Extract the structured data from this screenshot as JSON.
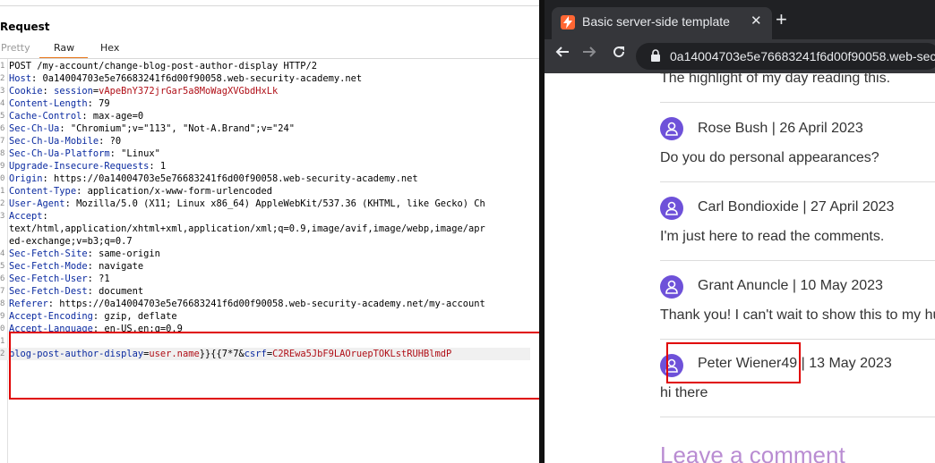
{
  "burp": {
    "title": "Request",
    "tabs": {
      "pretty": "Pretty",
      "raw": "Raw",
      "hex": "Hex"
    },
    "lines": [
      {
        "n": "1",
        "parts": [
          {
            "t": "POST /my-account/change-blog-post-author-display HTTP/2",
            "c": "v"
          }
        ]
      },
      {
        "n": "2",
        "parts": [
          {
            "t": "Host",
            "c": "k"
          },
          {
            "t": ": 0a14004703e5e76683241f6d00f90058.web-security-academy.net",
            "c": "v"
          }
        ]
      },
      {
        "n": "3",
        "parts": [
          {
            "t": "Cookie",
            "c": "k"
          },
          {
            "t": ": ",
            "c": "v"
          },
          {
            "t": "session",
            "c": "ck"
          },
          {
            "t": "=",
            "c": "v"
          },
          {
            "t": "vApeBnY372jrGar5a8MoWagXVGbdHxLk",
            "c": "cv"
          }
        ]
      },
      {
        "n": "4",
        "parts": [
          {
            "t": "Content-Length",
            "c": "k"
          },
          {
            "t": ": 79",
            "c": "v"
          }
        ]
      },
      {
        "n": "5",
        "parts": [
          {
            "t": "Cache-Control",
            "c": "k"
          },
          {
            "t": ": max-age=0",
            "c": "v"
          }
        ]
      },
      {
        "n": "6",
        "parts": [
          {
            "t": "Sec-Ch-Ua",
            "c": "k"
          },
          {
            "t": ": \"Chromium\";v=\"113\", \"Not-A.Brand\";v=\"24\"",
            "c": "v"
          }
        ]
      },
      {
        "n": "7",
        "parts": [
          {
            "t": "Sec-Ch-Ua-Mobile",
            "c": "k"
          },
          {
            "t": ": ?0",
            "c": "v"
          }
        ]
      },
      {
        "n": "8",
        "parts": [
          {
            "t": "Sec-Ch-Ua-Platform",
            "c": "k"
          },
          {
            "t": ": \"Linux\"",
            "c": "v"
          }
        ]
      },
      {
        "n": "9",
        "parts": [
          {
            "t": "Upgrade-Insecure-Requests",
            "c": "k"
          },
          {
            "t": ": 1",
            "c": "v"
          }
        ]
      },
      {
        "n": "0",
        "parts": [
          {
            "t": "Origin",
            "c": "k"
          },
          {
            "t": ": https://0a14004703e5e76683241f6d00f90058.web-security-academy.net",
            "c": "v"
          }
        ]
      },
      {
        "n": "1",
        "parts": [
          {
            "t": "Content-Type",
            "c": "k"
          },
          {
            "t": ": application/x-www-form-urlencoded",
            "c": "v"
          }
        ]
      },
      {
        "n": "2",
        "parts": [
          {
            "t": "User-Agent",
            "c": "k"
          },
          {
            "t": ": Mozilla/5.0 (X11; Linux x86_64) AppleWebKit/537.36 (KHTML, like Gecko) Ch",
            "c": "v"
          }
        ]
      },
      {
        "n": "3",
        "parts": [
          {
            "t": "Accept",
            "c": "k"
          },
          {
            "t": ":",
            "c": "v"
          }
        ]
      },
      {
        "n": "",
        "parts": [
          {
            "t": "text/html,application/xhtml+xml,application/xml;q=0.9,image/avif,image/webp,image/apr",
            "c": "v"
          }
        ]
      },
      {
        "n": "",
        "parts": [
          {
            "t": "ed-exchange;v=b3;q=0.7",
            "c": "v"
          }
        ]
      },
      {
        "n": "4",
        "parts": [
          {
            "t": "Sec-Fetch-Site",
            "c": "k"
          },
          {
            "t": ": same-origin",
            "c": "v"
          }
        ]
      },
      {
        "n": "5",
        "parts": [
          {
            "t": "Sec-Fetch-Mode",
            "c": "k"
          },
          {
            "t": ": navigate",
            "c": "v"
          }
        ]
      },
      {
        "n": "6",
        "parts": [
          {
            "t": "Sec-Fetch-User",
            "c": "k"
          },
          {
            "t": ": ?1",
            "c": "v"
          }
        ]
      },
      {
        "n": "7",
        "parts": [
          {
            "t": "Sec-Fetch-Dest",
            "c": "k"
          },
          {
            "t": ": document",
            "c": "v"
          }
        ]
      },
      {
        "n": "8",
        "parts": [
          {
            "t": "Referer",
            "c": "k"
          },
          {
            "t": ": https://0a14004703e5e76683241f6d00f90058.web-security-academy.net/my-account",
            "c": "v"
          }
        ]
      },
      {
        "n": "9",
        "parts": [
          {
            "t": "Accept-Encoding",
            "c": "k"
          },
          {
            "t": ": gzip, deflate",
            "c": "v"
          }
        ]
      },
      {
        "n": "0",
        "parts": [
          {
            "t": "Accept-Language",
            "c": "k"
          },
          {
            "t": ": en-US,en;q=0.9",
            "c": "v"
          }
        ]
      },
      {
        "n": "1",
        "parts": [
          {
            "t": "",
            "c": "v"
          }
        ]
      },
      {
        "n": "2",
        "hl": true,
        "parts": [
          {
            "t": "blog-post-author-display",
            "c": "pn"
          },
          {
            "t": "=",
            "c": "v"
          },
          {
            "t": "user.name",
            "c": "pv"
          },
          {
            "t": "}}{{7*7",
            "c": "v"
          },
          {
            "t": "&",
            "c": "v"
          },
          {
            "t": "csrf",
            "c": "pn"
          },
          {
            "t": "=",
            "c": "v"
          },
          {
            "t": "C2REwa5JbF9LAOruepTOKLstRUHBlmdP",
            "c": "pv"
          }
        ]
      }
    ]
  },
  "browser": {
    "tab_title": "Basic server-side template",
    "url": "0a14004703e5e76683241f6d00f90058.web-sec"
  },
  "page": {
    "top_text": "The highlight of my day reading this.",
    "comments": [
      {
        "author": "Rose Bush | 26 April 2023",
        "text": "Do you do personal appearances?"
      },
      {
        "author": "Carl Bondioxide | 27 April 2023",
        "text": "I'm just here to read the comments."
      },
      {
        "author": "Grant Anuncle | 10 May 2023",
        "text": "Thank you! I can't wait to show this to my hu"
      },
      {
        "author": "Peter Wiener49 | 13 May 2023",
        "text": "hi there"
      }
    ],
    "leave_comment": "Leave a comment"
  },
  "colors": {
    "highlight_box": "#e00000",
    "avatar": "#6e51d9",
    "leave_comment": "#b98cd2",
    "burp_tab_accent": "#e8761a"
  }
}
